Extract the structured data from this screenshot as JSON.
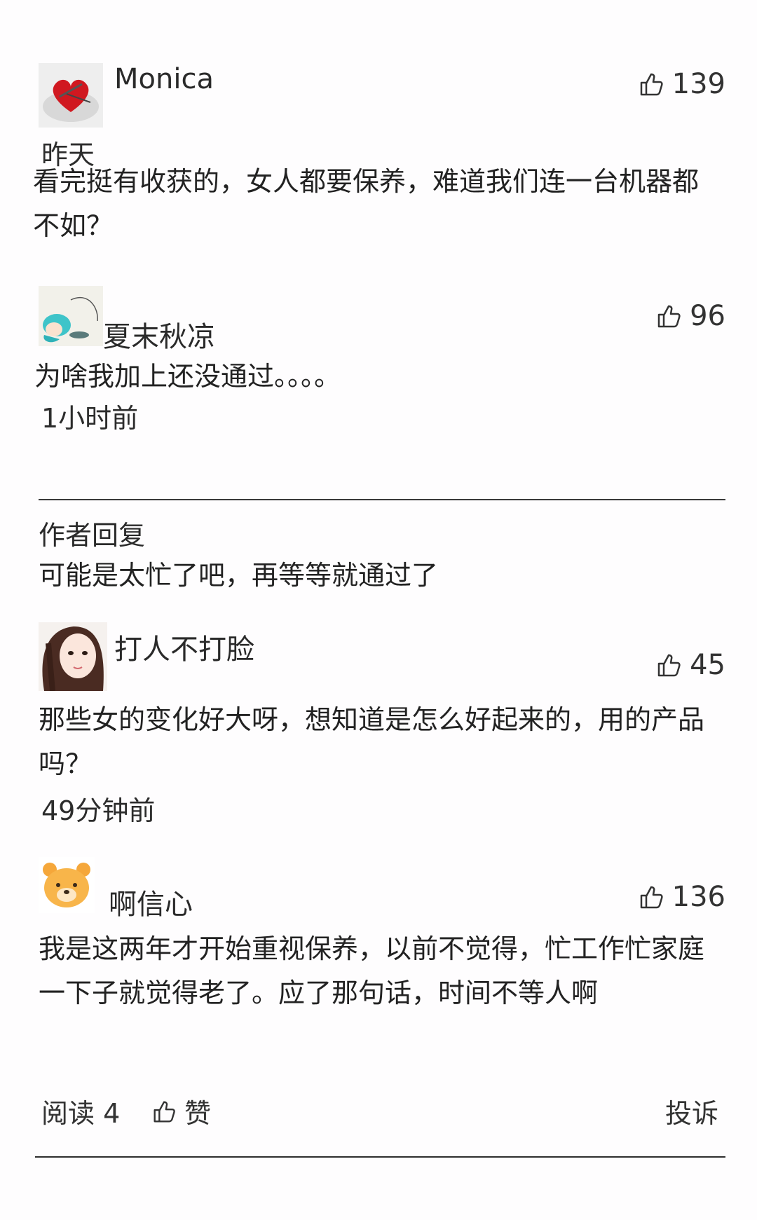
{
  "comments": [
    {
      "nickname": "Monica",
      "likes": "139",
      "time": "昨天",
      "text": "看完挺有收获的，女人都要保养，难道我们连一台机器都不如？",
      "avatar_icon": "red-heart-avatar"
    },
    {
      "nickname": "夏末秋凉",
      "likes": "96",
      "text": "为啥我加上还没通过。。。。",
      "time": "1小时前",
      "avatar_icon": "anime-girl-avatar",
      "author_reply": {
        "label": "作者回复",
        "text": "可能是太忙了吧，再等等就通过了"
      }
    },
    {
      "nickname": "打人不打脸",
      "likes": "45",
      "text": "那些女的变化好大呀，想知道是怎么好起来的，用的产品吗？",
      "time": "49分钟前",
      "avatar_icon": "girl-photo-avatar"
    },
    {
      "nickname": "啊信心",
      "likes": "136",
      "text": "我是这两年才开始重视保养，以前不觉得，忙工作忙家庭一下子就觉得老了。应了那句话，时间不等人啊",
      "avatar_icon": "cartoon-bear-avatar"
    }
  ],
  "footer": {
    "read_label": "阅读 4",
    "like_label": "赞",
    "report_label": "投诉"
  },
  "colors": {
    "text": "#222222",
    "divider": "#3a3a3a",
    "background": "#fefdfe"
  }
}
